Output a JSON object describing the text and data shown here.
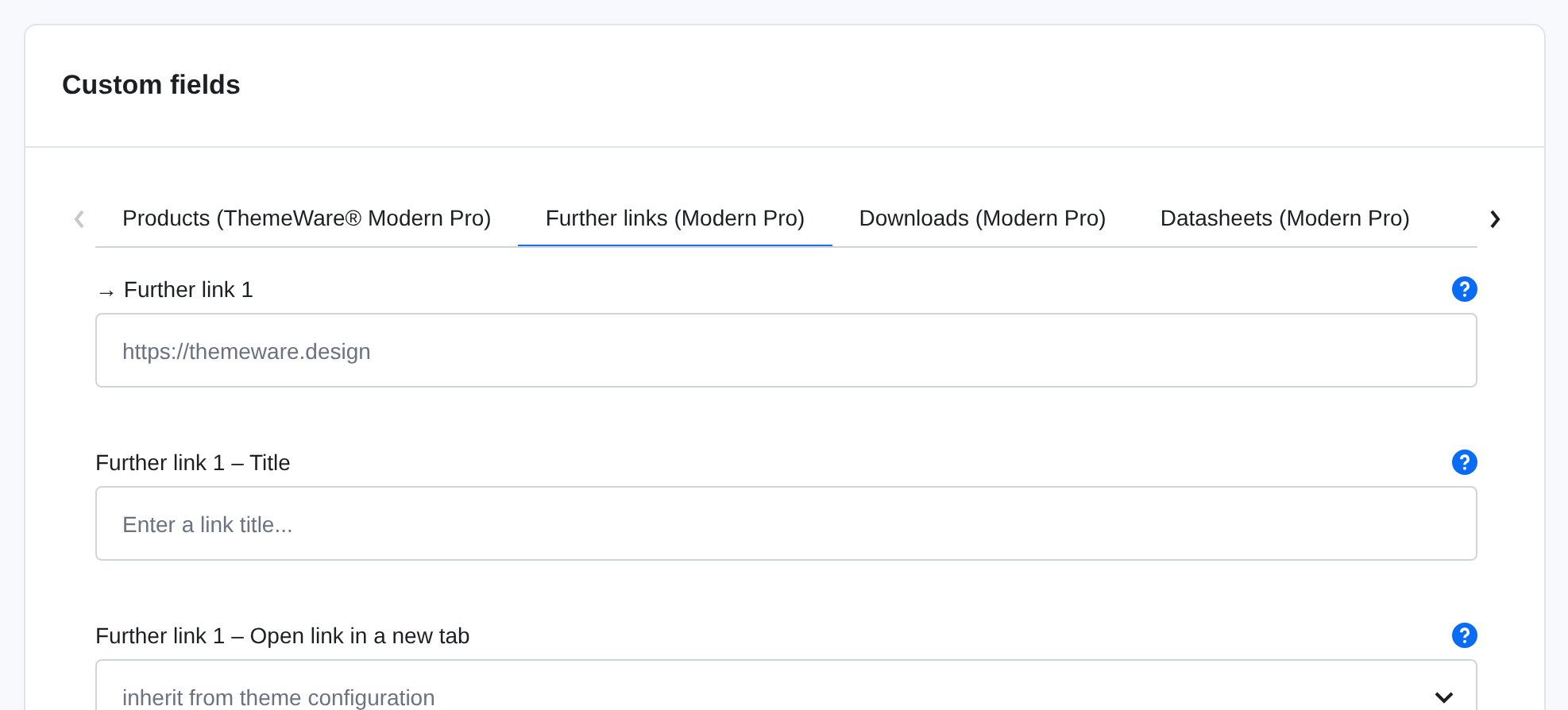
{
  "card": {
    "title": "Custom fields"
  },
  "tabs": [
    {
      "label": "Products (ThemeWare® Modern Pro)",
      "selected": false
    },
    {
      "label": "Further links (Modern Pro)",
      "selected": true
    },
    {
      "label": "Downloads (Modern Pro)",
      "selected": false
    },
    {
      "label": "Datasheets (Modern Pro)",
      "selected": false
    }
  ],
  "tab_scroll": {
    "prev_disabled": true,
    "next_disabled": false
  },
  "fields": [
    {
      "kind": "text",
      "label": "→ Further link 1",
      "placeholder": "https://themeware.design"
    },
    {
      "kind": "text",
      "label": "Further link 1 – Title",
      "placeholder": "Enter a link title..."
    },
    {
      "kind": "select",
      "label": "Further link 1 – Open link in a new tab",
      "value": "inherit from theme configuration"
    }
  ]
}
